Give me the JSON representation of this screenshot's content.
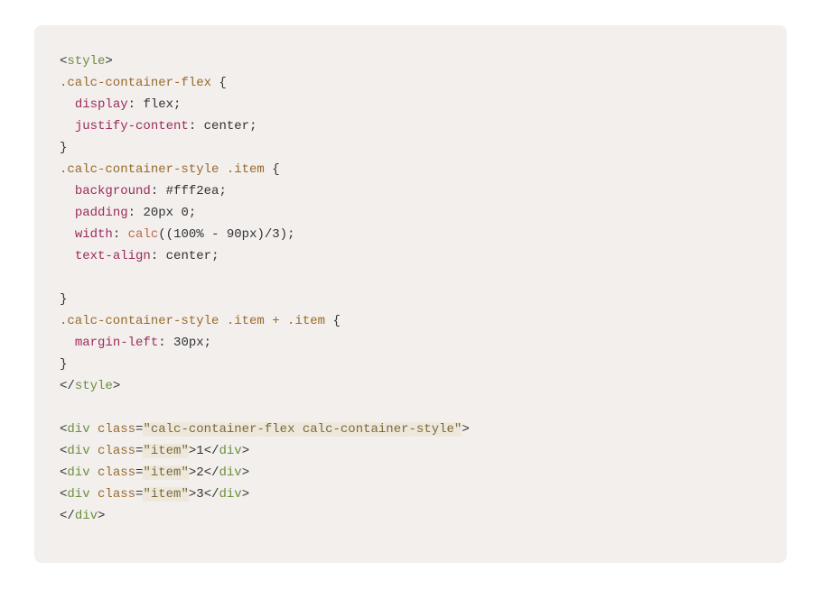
{
  "code": {
    "lines": [
      [
        {
          "cls": "angle",
          "t": "<"
        },
        {
          "cls": "tag",
          "t": "style"
        },
        {
          "cls": "angle",
          "t": ">"
        }
      ],
      [
        {
          "cls": "selector",
          "t": ".calc-container-flex"
        },
        {
          "cls": "punc",
          "t": " {"
        }
      ],
      [
        {
          "cls": "punc",
          "t": "  "
        },
        {
          "cls": "prop",
          "t": "display"
        },
        {
          "cls": "punc",
          "t": ": "
        },
        {
          "cls": "val",
          "t": "flex"
        },
        {
          "cls": "punc",
          "t": ";"
        }
      ],
      [
        {
          "cls": "punc",
          "t": "  "
        },
        {
          "cls": "prop",
          "t": "justify-content"
        },
        {
          "cls": "punc",
          "t": ": "
        },
        {
          "cls": "val",
          "t": "center"
        },
        {
          "cls": "punc",
          "t": ";"
        }
      ],
      [
        {
          "cls": "punc",
          "t": "}"
        }
      ],
      [
        {
          "cls": "selector",
          "t": ".calc-container-style .item"
        },
        {
          "cls": "punc",
          "t": " {"
        }
      ],
      [
        {
          "cls": "punc",
          "t": "  "
        },
        {
          "cls": "prop",
          "t": "background"
        },
        {
          "cls": "punc",
          "t": ": "
        },
        {
          "cls": "val",
          "t": "#fff2ea"
        },
        {
          "cls": "punc",
          "t": ";"
        }
      ],
      [
        {
          "cls": "punc",
          "t": "  "
        },
        {
          "cls": "prop",
          "t": "padding"
        },
        {
          "cls": "punc",
          "t": ": "
        },
        {
          "cls": "val",
          "t": "20px 0"
        },
        {
          "cls": "punc",
          "t": ";"
        }
      ],
      [
        {
          "cls": "punc",
          "t": "  "
        },
        {
          "cls": "prop",
          "t": "width"
        },
        {
          "cls": "punc",
          "t": ": "
        },
        {
          "cls": "func",
          "t": "calc"
        },
        {
          "cls": "paren",
          "t": "(("
        },
        {
          "cls": "val",
          "t": "100% - 90px"
        },
        {
          "cls": "paren",
          "t": ")/"
        },
        {
          "cls": "val",
          "t": "3"
        },
        {
          "cls": "paren",
          "t": ")"
        },
        {
          "cls": "punc",
          "t": ";"
        }
      ],
      [
        {
          "cls": "punc",
          "t": "  "
        },
        {
          "cls": "prop",
          "t": "text-align"
        },
        {
          "cls": "punc",
          "t": ": "
        },
        {
          "cls": "val",
          "t": "center"
        },
        {
          "cls": "punc",
          "t": ";"
        }
      ],
      [
        {
          "cls": "punc",
          "t": " "
        }
      ],
      [
        {
          "cls": "punc",
          "t": "}"
        }
      ],
      [
        {
          "cls": "selector",
          "t": ".calc-container-style .item + .item"
        },
        {
          "cls": "punc",
          "t": " {"
        }
      ],
      [
        {
          "cls": "punc",
          "t": "  "
        },
        {
          "cls": "prop",
          "t": "margin-left"
        },
        {
          "cls": "punc",
          "t": ": "
        },
        {
          "cls": "val",
          "t": "30px"
        },
        {
          "cls": "punc",
          "t": ";"
        }
      ],
      [
        {
          "cls": "punc",
          "t": "}"
        }
      ],
      [
        {
          "cls": "angle",
          "t": "</"
        },
        {
          "cls": "tag",
          "t": "style"
        },
        {
          "cls": "angle",
          "t": ">"
        }
      ],
      [
        {
          "cls": "punc",
          "t": " "
        }
      ],
      [
        {
          "cls": "angle",
          "t": "<"
        },
        {
          "cls": "tag",
          "t": "div"
        },
        {
          "cls": "punc",
          "t": " "
        },
        {
          "cls": "attr",
          "t": "class"
        },
        {
          "cls": "punc",
          "t": "="
        },
        {
          "cls": "str",
          "t": "\"calc-container-flex calc-container-style\""
        },
        {
          "cls": "angle",
          "t": ">"
        }
      ],
      [
        {
          "cls": "angle",
          "t": "<"
        },
        {
          "cls": "tag",
          "t": "div"
        },
        {
          "cls": "punc",
          "t": " "
        },
        {
          "cls": "attr",
          "t": "class"
        },
        {
          "cls": "punc",
          "t": "="
        },
        {
          "cls": "str",
          "t": "\"item\""
        },
        {
          "cls": "angle",
          "t": ">"
        },
        {
          "cls": "text",
          "t": "1"
        },
        {
          "cls": "angle",
          "t": "</"
        },
        {
          "cls": "tag",
          "t": "div"
        },
        {
          "cls": "angle",
          "t": ">"
        }
      ],
      [
        {
          "cls": "angle",
          "t": "<"
        },
        {
          "cls": "tag",
          "t": "div"
        },
        {
          "cls": "punc",
          "t": " "
        },
        {
          "cls": "attr",
          "t": "class"
        },
        {
          "cls": "punc",
          "t": "="
        },
        {
          "cls": "str",
          "t": "\"item\""
        },
        {
          "cls": "angle",
          "t": ">"
        },
        {
          "cls": "text",
          "t": "2"
        },
        {
          "cls": "angle",
          "t": "</"
        },
        {
          "cls": "tag",
          "t": "div"
        },
        {
          "cls": "angle",
          "t": ">"
        }
      ],
      [
        {
          "cls": "angle",
          "t": "<"
        },
        {
          "cls": "tag",
          "t": "div"
        },
        {
          "cls": "punc",
          "t": " "
        },
        {
          "cls": "attr",
          "t": "class"
        },
        {
          "cls": "punc",
          "t": "="
        },
        {
          "cls": "str",
          "t": "\"item\""
        },
        {
          "cls": "angle",
          "t": ">"
        },
        {
          "cls": "text",
          "t": "3"
        },
        {
          "cls": "angle",
          "t": "</"
        },
        {
          "cls": "tag",
          "t": "div"
        },
        {
          "cls": "angle",
          "t": ">"
        }
      ],
      [
        {
          "cls": "angle",
          "t": "</"
        },
        {
          "cls": "tag",
          "t": "div"
        },
        {
          "cls": "angle",
          "t": ">"
        }
      ]
    ]
  }
}
